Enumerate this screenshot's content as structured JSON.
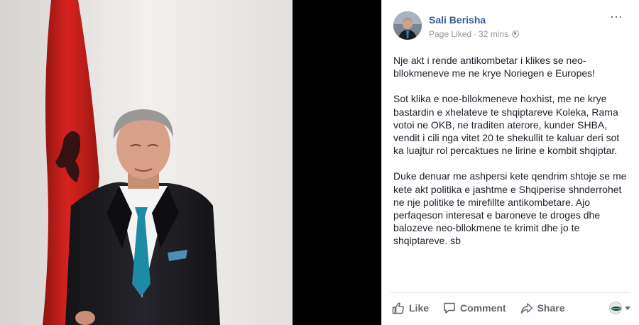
{
  "post": {
    "author": "Sali Berisha",
    "status": "Page Liked",
    "separator": "·",
    "time": "32 mins",
    "more_icon": "⋯",
    "paragraphs": [
      "Nje akt i rende antikombetar i klikes se neo-bllokmeneve me ne krye Noriegen e Europes!",
      "Sot klika e noe-bllokmeneve hoxhist, me ne krye bastardin e xhelateve te shqiptareve Koleka, Rama votoi ne OKB, ne traditen aterore, kunder SHBA, vendit i cili nga vitet 20 te shekullit te kaluar deri sot ka luajtur rol percaktues ne lirine e kombit shqiptar.",
      "Duke denuar me ashpersi kete qendrim shtoje se me kete akt politika e jashtme e Shqiperise shnderrohet ne nje politike te mirefillte antikombetare. Ajo perfaqeson interesat e baroneve te droges dhe balozeve neo-bllokmene te krimit dhe jo te shqiptareve. sb"
    ]
  },
  "actions": {
    "like": "Like",
    "comment": "Comment",
    "share": "Share"
  },
  "icons": {
    "like": "thumbs-up-icon",
    "comment": "comment-bubble-icon",
    "share": "share-arrow-icon",
    "privacy": "globe-icon",
    "more": "more-options-icon"
  },
  "colors": {
    "author_link": "#365899",
    "meta_text": "#90949c",
    "body_text": "#1d2129",
    "action_text": "#606770",
    "flag_red": "#d2211e",
    "background": "#000000"
  }
}
